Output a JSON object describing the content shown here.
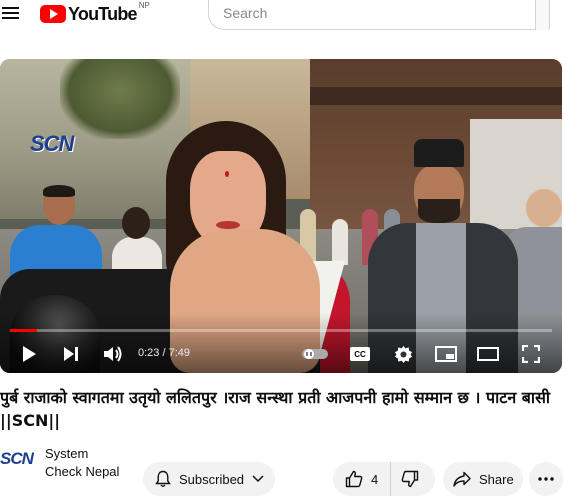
{
  "header": {
    "logo_text": "YouTube",
    "region": "NP",
    "search_placeholder": "Search"
  },
  "player": {
    "watermark": "SCN",
    "current_time": "0:23",
    "separator": " / ",
    "duration": "7:49",
    "progress_fraction": 0.049,
    "accent_color": "#ff0000"
  },
  "video": {
    "title": "पुर्ब राजाको स्वागतमा उतृयो ललितपुर ।राज सन्स्था प्रती आजपनी हामो सम्मान छ । पाटन बासी ||SCN||"
  },
  "channel": {
    "avatar_text": "SCN",
    "name": "System Check Nepal"
  },
  "actions": {
    "subscribe_label": "Subscribed",
    "like_count": "4",
    "share_label": "Share"
  },
  "icons": [
    "menu-icon",
    "youtube-logo-icon",
    "play-icon",
    "next-icon",
    "volume-icon",
    "autoplay-toggle-icon",
    "captions-icon",
    "settings-gear-icon",
    "miniplayer-icon",
    "theater-icon",
    "fullscreen-icon",
    "bell-icon",
    "chevron-down-icon",
    "thumbs-up-icon",
    "thumbs-down-icon",
    "share-icon",
    "more-icon"
  ]
}
